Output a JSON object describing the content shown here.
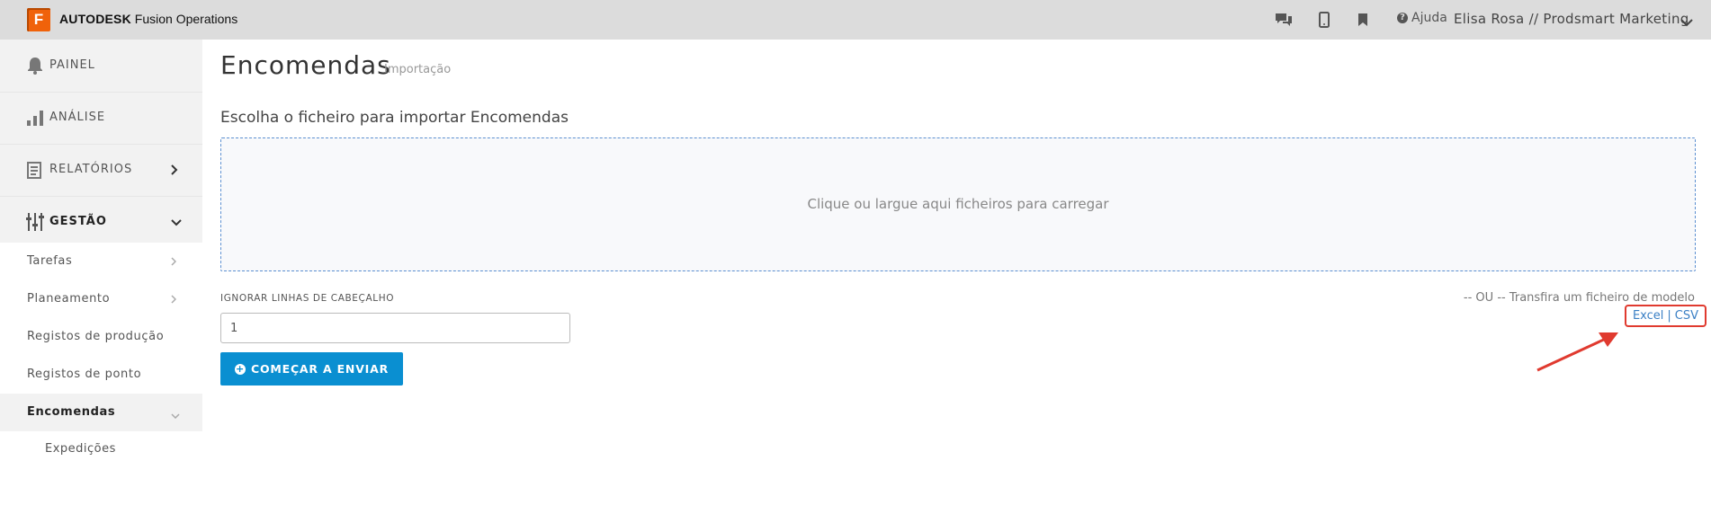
{
  "header": {
    "logo_letter": "F",
    "brand_bold": "AUTODESK",
    "brand_rest": "Fusion Operations",
    "help_label": "Ajuda",
    "user_label": "Elisa Rosa // Prodsmart Marketing",
    "icons": [
      "chat-icon",
      "mobile-icon",
      "bookmark-icon",
      "help-icon",
      "chevron-down-icon"
    ]
  },
  "sidebar": {
    "main_items": [
      {
        "label": "PAINEL",
        "icon": "bell-icon"
      },
      {
        "label": "ANÁLISE",
        "icon": "bar-chart-icon"
      },
      {
        "label": "RELATÓRIOS",
        "icon": "report-icon"
      },
      {
        "label": "GESTÃO",
        "icon": "sliders-icon"
      }
    ],
    "sub_items": [
      {
        "label": "Tarefas"
      },
      {
        "label": "Planeamento"
      },
      {
        "label": "Registos de produção"
      },
      {
        "label": "Registos de ponto"
      },
      {
        "label": "Encomendas",
        "active": true
      }
    ],
    "subsub_items": [
      {
        "label": "Expedições"
      }
    ]
  },
  "main": {
    "title": "Encomendas",
    "subtitle": "Importação",
    "heading": "Escolha o ficheiro para importar Encomendas",
    "dropzone_text": "Clique ou largue aqui ficheiros para carregar",
    "skip_label": "IGNORAR LINHAS DE CABEÇALHO",
    "skip_value": "1",
    "submit_label": "COMEÇAR A ENVIAR",
    "template_hint": "-- OU -- Transfira um ficheiro de modelo",
    "template_excel": "Excel",
    "template_sep": "|",
    "template_csv": "CSV"
  },
  "colors": {
    "accent": "#0a8fd1",
    "brand": "#f0620a",
    "highlight": "#e03a2f"
  }
}
